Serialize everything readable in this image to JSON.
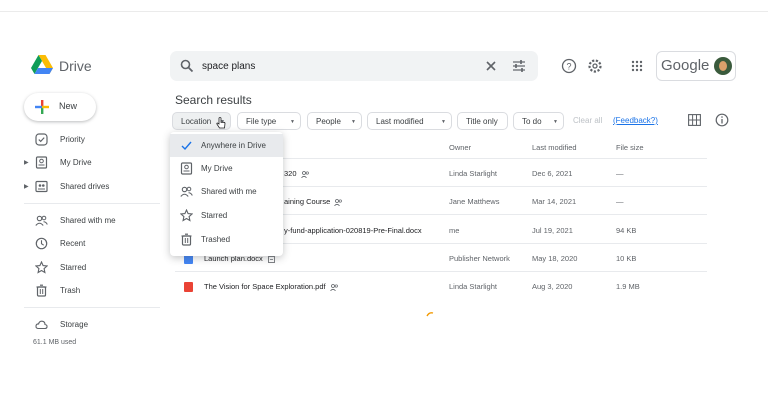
{
  "app": {
    "brand": "Drive"
  },
  "search": {
    "query": "space plans"
  },
  "account": {
    "label": "Google"
  },
  "sidebar": {
    "new_label": "New",
    "items": [
      {
        "label": "Priority",
        "icon": "check-circle-icon"
      },
      {
        "label": "My Drive",
        "icon": "my-drive-icon"
      },
      {
        "label": "Shared drives",
        "icon": "shared-drives-icon"
      },
      {
        "label": "Shared with me",
        "icon": "people-icon"
      },
      {
        "label": "Recent",
        "icon": "clock-icon"
      },
      {
        "label": "Starred",
        "icon": "star-icon"
      },
      {
        "label": "Trash",
        "icon": "trash-icon"
      },
      {
        "label": "Storage",
        "icon": "cloud-icon"
      }
    ],
    "usage": "61.1 MB used"
  },
  "main": {
    "title": "Search results",
    "filters": [
      "Location",
      "File type",
      "People",
      "Last modified",
      "Title only",
      "To do"
    ],
    "clear_all": "Clear all",
    "feedback": "(Feedback?)",
    "columns": [
      "Owner",
      "Last modified",
      "File size"
    ],
    "rows": [
      {
        "name": "320",
        "shared": true,
        "type": "folder",
        "owner": "Linda Starlight",
        "modified": "Dec 6, 2021",
        "size": "—"
      },
      {
        "name": "aining Course",
        "shared": true,
        "type": "folder",
        "owner": "Jane Matthews",
        "modified": "Mar 14, 2021",
        "size": "—"
      },
      {
        "name": "y-fund-application-020819-Pre-Final.docx",
        "shared": false,
        "type": "doc",
        "owner": "me",
        "modified": "Jul 19, 2021",
        "size": "94 KB"
      },
      {
        "name": "Launch plan.docx",
        "shared": false,
        "type": "doc",
        "owner": "Publisher Network",
        "modified": "May 18, 2020",
        "size": "10 KB"
      },
      {
        "name": "The Vision for Space Exploration.pdf",
        "shared": true,
        "type": "pdf",
        "owner": "Linda Starlight",
        "modified": "Aug 3, 2020",
        "size": "1.9 MB"
      }
    ]
  },
  "location_menu": {
    "items": [
      {
        "label": "Anywhere in Drive",
        "icon": "check-icon",
        "selected": true
      },
      {
        "label": "My Drive",
        "icon": "my-drive-icon",
        "selected": false
      },
      {
        "label": "Shared with me",
        "icon": "people-icon",
        "selected": false
      },
      {
        "label": "Starred",
        "icon": "star-icon",
        "selected": false
      },
      {
        "label": "Trashed",
        "icon": "trash-icon",
        "selected": false
      }
    ]
  },
  "colors": {
    "accent": "#1a73e8",
    "pdf": "#ea4335",
    "doc": "#4285f4",
    "selected_bg": "#e8eaed"
  }
}
